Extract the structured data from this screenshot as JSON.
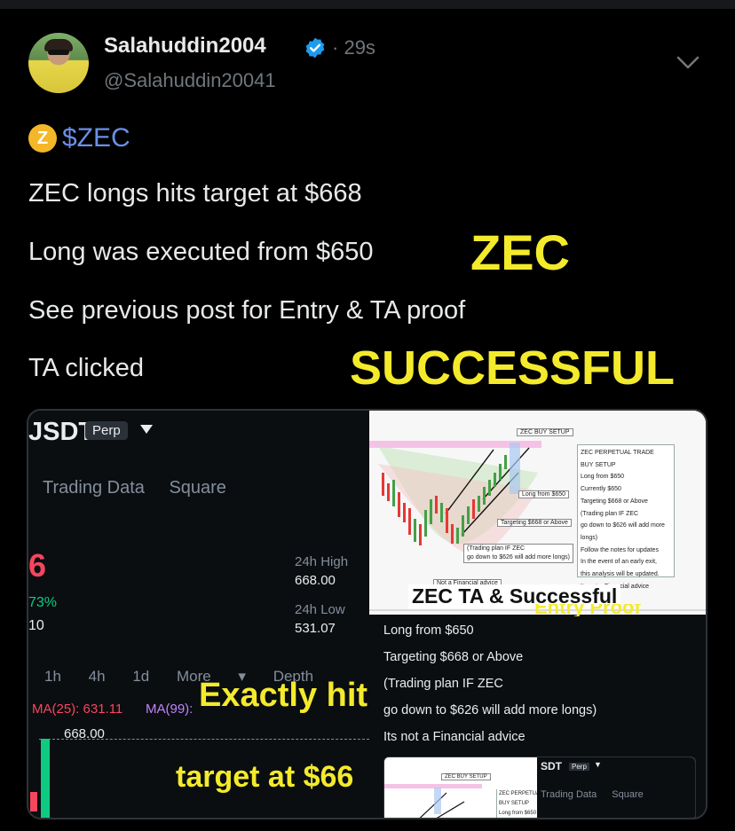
{
  "tweet": {
    "display_name": "Salahuddin2004",
    "time": "29s",
    "handle": "@Salahuddin20041",
    "cashtag": "$ZEC",
    "coin_glyph": "Z",
    "lines": [
      "ZEC longs hits target at $668",
      "Long was executed from $650",
      "See previous post for Entry & TA proof",
      "TA clicked"
    ],
    "overlay_zec": "ZEC",
    "overlay_successful": "SUCCESSFUL",
    "colors": {
      "verified": "#1d9bf0",
      "cashtag": "#6b8fe8",
      "overlay": "#f4ea2c",
      "coin": "#f4b728"
    }
  },
  "media": {
    "left": {
      "pair": "JSDT",
      "perp": "Perp",
      "tabs": [
        "Trading Data",
        "Square"
      ],
      "price_fragment": "6",
      "pct_fragment": "73%",
      "vol_fragment": "10",
      "high_label": "24h High",
      "high_value": "668.00",
      "low_label": "24h Low",
      "low_value": "531.07",
      "intervals": [
        "1h",
        "4h",
        "1d",
        "More",
        "Depth"
      ],
      "ma25": "MA(25): 631.11",
      "ma99": "MA(99):",
      "line_value": "668.00",
      "overlay_1": "Exactly hit",
      "overlay_2": "target at $66"
    },
    "right": {
      "chart_title": "ZEC BUY SETUP",
      "notes": [
        "ZEC PERPETUAL TRADE",
        "BUY SETUP",
        "Long from $650",
        "Currently $650",
        "Targeting $668 or Above",
        "(Trading plan IF ZEC",
        "go down to $626 will add more longs)",
        "Follow the notes for updates",
        "In the event of an early exit,",
        "this analysis will be updated.",
        "Its not a Financial advice"
      ],
      "tag_long": "Long from $650",
      "tag_target": "Targeting $668 or Above",
      "tag_plan_1": "(Trading plan IF ZEC",
      "tag_plan_2": "go down to $626 will add more longs)",
      "tag_nfa": "Not a Financial advice",
      "caption": "ZEC TA & Successful",
      "caption_under": "Entry Proof",
      "text_lines": [
        "Long from $650",
        "Targeting $668 or Above",
        "(Trading plan IF ZEC",
        "go down to $626 will add more longs)",
        "Its not a Financial advice"
      ],
      "nested": {
        "chart_title": "ZEC BUY SETUP",
        "pair": "SDT",
        "perp": "Perp",
        "tabs": [
          "Trading Data",
          "Square"
        ],
        "notes": [
          "ZEC PERPETUAL T",
          "BUY SETUP",
          "Long from $650"
        ]
      }
    }
  }
}
